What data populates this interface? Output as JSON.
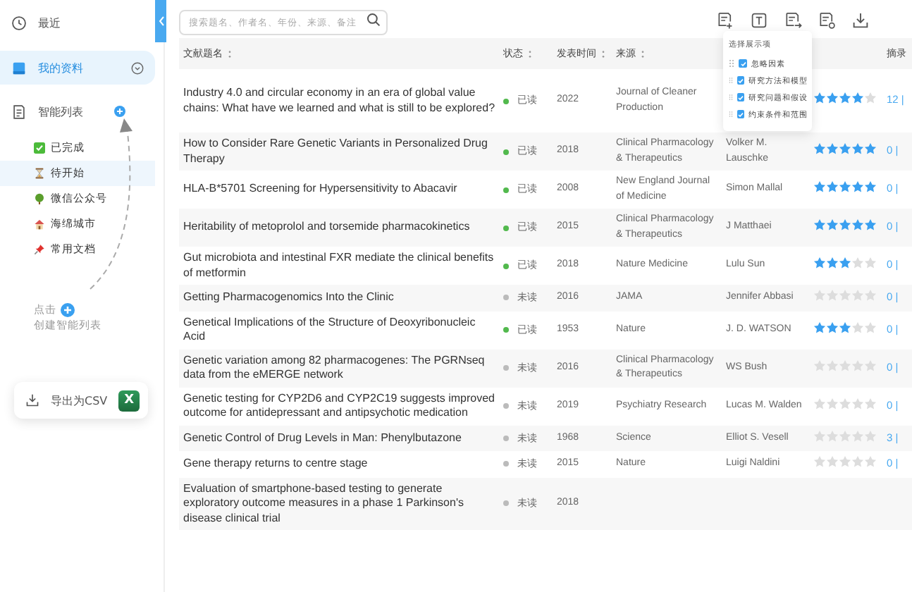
{
  "sidebar": {
    "items": [
      {
        "label": "最近",
        "selected": false
      },
      {
        "label": "我的资料",
        "selected": true
      }
    ],
    "smart_list": {
      "label": "智能列表",
      "children": [
        {
          "label": "已完成",
          "selected": false
        },
        {
          "label": "待开始",
          "selected": true
        },
        {
          "label": "微信公众号",
          "selected": false
        },
        {
          "label": "海绵城市",
          "selected": false
        },
        {
          "label": "常用文档",
          "selected": false
        }
      ]
    },
    "hint": {
      "before": "点击",
      "after": "创建智能列表"
    },
    "export_button": "导出为CSV",
    "export_badge": "X"
  },
  "search": {
    "placeholder": "搜索题名、作者名、年份、来源、备注"
  },
  "columns": [
    "文献题名",
    "状态",
    "发表时间",
    "来源",
    "摘录"
  ],
  "column_popup": {
    "title": "选择展示项",
    "options": [
      {
        "label": "忽略因素",
        "checked": true
      },
      {
        "label": "研究方法和模型",
        "checked": true
      },
      {
        "label": "研究问题和假设",
        "checked": true
      },
      {
        "label": "约束条件和范围",
        "checked": true
      }
    ]
  },
  "rows": [
    {
      "title": "Industry 4.0 and circular economy in an era of global value chains: What have we learned and what is still to be explored?",
      "status": "已读",
      "read": true,
      "year": "2022",
      "source": "Journal of Cleaner Production",
      "author": "",
      "stars": 4,
      "excerpt": "12 |"
    },
    {
      "title": "How to Consider Rare Genetic Variants in Personalized Drug Therapy",
      "status": "已读",
      "read": true,
      "year": "2018",
      "source": "Clinical Pharmacology & Therapeutics",
      "author": "Volker M. Lauschke",
      "stars": 5,
      "excerpt": "0 |"
    },
    {
      "title": "HLA-B*5701 Screening for Hypersensitivity to Abacavir",
      "status": "已读",
      "read": true,
      "year": "2008",
      "source": "New England Journal of Medicine",
      "author": "Simon Mallal",
      "stars": 5,
      "excerpt": "0 |"
    },
    {
      "title": "Heritability of metoprolol and torsemide pharmacokinetics",
      "status": "已读",
      "read": true,
      "year": "2015",
      "source": "Clinical Pharmacology & Therapeutics",
      "author": "J Matthaei",
      "stars": 5,
      "excerpt": "0 |"
    },
    {
      "title": "Gut microbiota and intestinal FXR mediate the clinical benefits of metformin",
      "status": "已读",
      "read": true,
      "year": "2018",
      "source": "Nature Medicine",
      "author": "Lulu Sun",
      "stars": 3,
      "excerpt": "0 |"
    },
    {
      "title": "Getting Pharmacogenomics Into the Clinic",
      "status": "未读",
      "read": false,
      "year": "2016",
      "source": "JAMA",
      "author": "Jennifer Abbasi",
      "stars": 0,
      "excerpt": "0 |"
    },
    {
      "title": "Genetical Implications of the Structure of Deoxyribonucleic Acid",
      "status": "已读",
      "read": true,
      "year": "1953",
      "source": "Nature",
      "author": "J. D. WATSON",
      "stars": 3,
      "excerpt": "0 |"
    },
    {
      "title": "Genetic variation among 82 pharmacogenes: The PGRNseq data from the eMERGE network",
      "status": "未读",
      "read": false,
      "year": "2016",
      "source": "Clinical Pharmacology & Therapeutics",
      "author": "WS Bush",
      "stars": 0,
      "excerpt": "0 |"
    },
    {
      "title": "Genetic testing for CYP2D6 and CYP2C19 suggests improved outcome for antidepressant and antipsychotic medication",
      "status": "未读",
      "read": false,
      "year": "2019",
      "source": "Psychiatry Research",
      "author": "Lucas M. Walden",
      "stars": 0,
      "excerpt": "0 |"
    },
    {
      "title": "Genetic Control of Drug Levels in Man: Phenylbutazone",
      "status": "未读",
      "read": false,
      "year": "1968",
      "source": "Science",
      "author": "Elliot S. Vesell",
      "stars": 0,
      "excerpt": "3 |"
    },
    {
      "title": "Gene therapy returns to centre stage",
      "status": "未读",
      "read": false,
      "year": "2015",
      "source": "Nature",
      "author": "Luigi Naldini",
      "stars": 0,
      "excerpt": "0 |"
    },
    {
      "title": "Evaluation of smartphone-based testing to generate exploratory outcome measures in a phase 1 Parkinson's disease clinical trial",
      "status": "未读",
      "read": false,
      "year": "2018"
    }
  ]
}
